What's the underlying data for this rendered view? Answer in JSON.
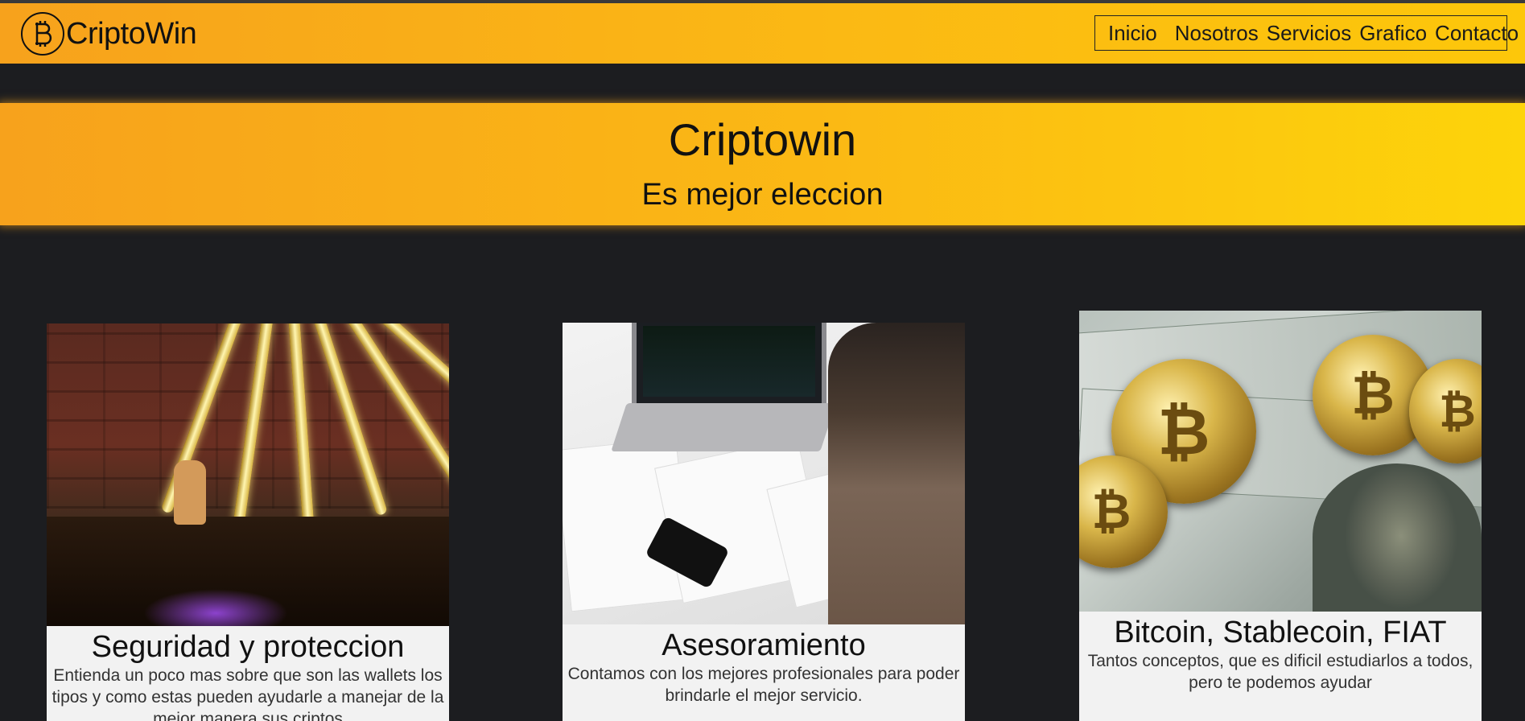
{
  "navbar": {
    "brand": "CriptoWin",
    "logo_icon": "bitcoin-icon",
    "links": [
      "Inicio",
      "Nosotros",
      "Servicios",
      "Grafico",
      "Contacto"
    ]
  },
  "hero": {
    "title": "Criptowin",
    "subtitle": "Es mejor eleccion"
  },
  "cards": [
    {
      "title": "Seguridad y proteccion",
      "text": "Entienda un poco mas sobre que son las wallets los tipos y como estas pueden ayudarle a manejar de la mejor manera sus criptos",
      "image": "shiba-dog-with-coin-and-light-rods"
    },
    {
      "title": "Asesoramiento",
      "text": "Contamos con los mejores profesionales para poder brindarle el mejor servicio.",
      "image": "person-with-laptop-and-phone-trading-charts"
    },
    {
      "title": "Bitcoin, Stablecoin, FIAT",
      "text": "Tantos conceptos, que es dificil estudiarlos a todos, pero te podemos ayudar",
      "image": "bitcoins-on-dollar-bills"
    }
  ],
  "colors": {
    "background": "#1c1d20",
    "accent_orange": "#f7a21c",
    "accent_yellow": "#fdc70a"
  }
}
